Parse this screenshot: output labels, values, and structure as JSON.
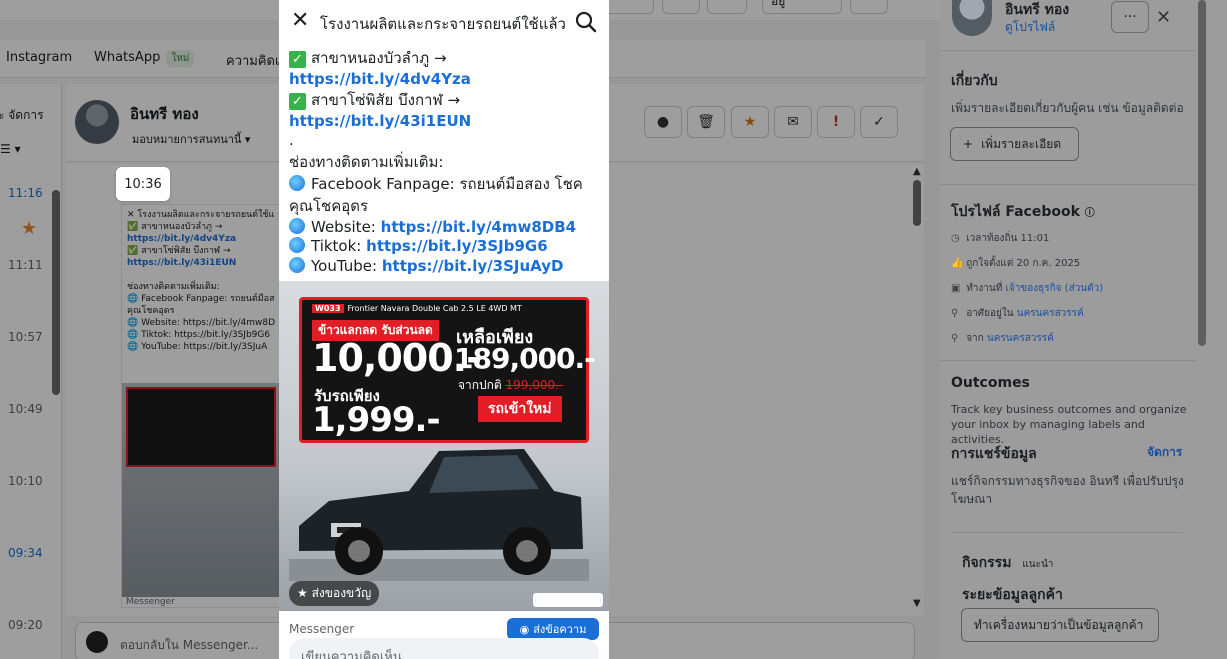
{
  "top_bar": {
    "status_label": "อยู่"
  },
  "channels": {
    "instagram": "Instagram",
    "whatsapp": "WhatsApp",
    "whatsapp_badge": "ใหม่",
    "comments": "ความคิดเห็"
  },
  "left_col": {
    "manage": "จัดการ",
    "times": [
      "11:16",
      "11:11",
      "10:57",
      "10:49",
      "10:10",
      "09:34",
      "09:20"
    ]
  },
  "conversation": {
    "name": "อินทรี ทอง",
    "assign": "มอบหมายการสนทนานี้",
    "tooltip_time": "10:36",
    "composer_placeholder": "ตอบกลับใน Messenger..."
  },
  "thumb": {
    "title": "โรงงานผลิตและกระจายรถยนต์ใช้แล้ว",
    "line1": "✅ สาขาหนองบัวลำภู →",
    "link1": "https://bit.ly/4dv4Yza",
    "line2": "✅ สาขาโซ่พิสัย บึงกาฬ →",
    "link2": "https://bit.ly/43i1EUN",
    "line3": "ช่องทางติดตามเพิ่มเติม:",
    "line4": "🌐 Facebook Fanpage: รถยนต์มือส",
    "line5": "คุณโชคอุดร",
    "line6": "🌐 Website: https://bit.ly/4mw8D",
    "line7": "🌐 Tiktok: https://bit.ly/3SJb9G6",
    "line8": "🌐 YouTube: https://bit.ly/3SJuA",
    "footer": "Messenger"
  },
  "modal": {
    "title": "โรงงานผลิตและกระจายรถยนต์ใช้แล้ว โ...",
    "line_branch1": "สาขาหนองบัวลำภู →",
    "link1": "https://bit.ly/4dv4Yza",
    "line_branch2": "สาขาโซ่พิสัย บึงกาฬ →",
    "link2": "https://bit.ly/43i1EUN",
    "dot": ".",
    "follow_heading": "ช่องทางติดตามเพิ่มเติม:",
    "fb_label": "Facebook Fanpage: รถยนต์มือสอง โชค",
    "fb_label2": "คุณโชคอุดร",
    "web_label": "Website:",
    "web_link": "https://bit.ly/4mw8DB4",
    "tiktok_label": "Tiktok:",
    "tiktok_link": "https://bit.ly/3SJb9G6",
    "youtube_label": "YouTube:",
    "youtube_link": "https://bit.ly/3SJuAyD",
    "gift_badge": "ส่งของขวัญ",
    "footer_label": "Messenger",
    "send_button": "ส่งข้อความ",
    "comment_placeholder": "เขียนความคิดเห็น..."
  },
  "ad": {
    "model": "Frontier Navara Double Cab 2.5 LE 4WD MT",
    "code": "W033",
    "red_tag": "ข้าวแลกลด รับส่วนลด",
    "discount": "10,000.-",
    "sub": "รับรถเพียง",
    "down": "1,999.-",
    "right1": "เหลือเพียง",
    "price": "189,000.-",
    "from_label": "จากปกติ",
    "old_price": "199,000.-",
    "pill": "รถเข้าใหม่"
  },
  "right_panel": {
    "name": "อินทรี ทอง",
    "profile_link": "ดูโปรไฟล์",
    "about_heading": "เกี่ยวกับ",
    "about_desc": "เพิ่มรายละเอียดเกี่ยวกับผู้คน เช่น ข้อมูลติดต่อ",
    "add_detail_button": "เพิ่มรายละเอียด",
    "fb_profile_heading": "โปรไฟล์ Facebook",
    "info_rows": [
      {
        "icon": "clock-icon",
        "text": "เวลาท้องถิ่น 11:01",
        "link": ""
      },
      {
        "icon": "thumbs-up-icon",
        "text": "ถูกใจตั้งแต่ 20 ก.ค. 2025",
        "link": ""
      },
      {
        "icon": "briefcase-icon",
        "text": "ทำงานที่ ",
        "link": "เจ้าของธุรกิจ (ส่วนตัว)"
      },
      {
        "icon": "pin-icon",
        "text": "อาศัยอยู่ใน ",
        "link": "นครนครสวรรค์"
      },
      {
        "icon": "pin-icon",
        "text": "จาก ",
        "link": "นครนครสวรรค์"
      }
    ],
    "outcomes_heading": "Outcomes",
    "outcomes_desc": "Track key business outcomes and organize your inbox by managing labels and activities.",
    "sharing_heading": "การแชร์ข้อมูล",
    "sharing_manage": "จัดการ",
    "sharing_desc": "แชร์กิจกรรมทางธุรกิจของ อินทรี เพื่อปรับปรุงโฆษณา",
    "activity_heading": "กิจกรรม",
    "activity_tag": "แนะนำ",
    "customer_stage_heading": "ระยะข้อมูลลูกค้า",
    "mark_customer_button": "ทำเครื่องหมายว่าเป็นข้อมูลลูกค้า"
  }
}
